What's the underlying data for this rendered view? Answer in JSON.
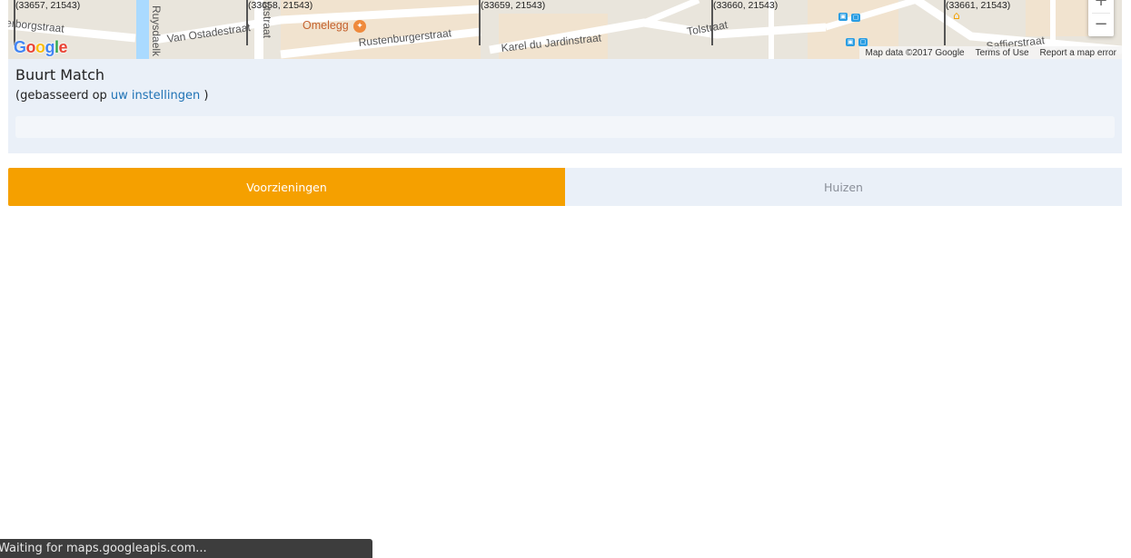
{
  "map": {
    "tile_labels": [
      "(33657, 21543)",
      "(33658, 21543)",
      "(33659, 21543)",
      "(33660, 21543)",
      "(33661, 21543)"
    ],
    "streets": {
      "s1": "erborgstraat",
      "s2": "Ruysdaelk",
      "s3": "Van Ostadestraat",
      "s4": "ntstraat",
      "s5": "Rustenburgerstraat",
      "s6": "Karel du Jardinstraat",
      "s7": "Tolstraat",
      "s8": "Saffierstraat"
    },
    "poi_label": "Omelegg",
    "poi_icon": "restaurant-icon",
    "logo_letters": [
      "G",
      "o",
      "o",
      "g",
      "l",
      "e"
    ],
    "attribution": {
      "map_data": "Map data ©2017 Google",
      "terms": "Terms of Use",
      "report": "Report a map error"
    },
    "zoom_in": "+",
    "zoom_out": "−"
  },
  "panel": {
    "title": "Buurt Match",
    "subtitle_prefix": "(gebasseerd op ",
    "subtitle_link": "uw instellingen",
    "subtitle_suffix": " )"
  },
  "tabs": [
    {
      "label": "Voorzieningen",
      "active": true
    },
    {
      "label": "Huizen",
      "active": false
    }
  ],
  "colors": {
    "accent": "#f5a000",
    "panel_bg": "#eaf0f8",
    "link": "#1f72b5"
  },
  "status": {
    "text": "Waiting for maps.googleapis.com..."
  }
}
